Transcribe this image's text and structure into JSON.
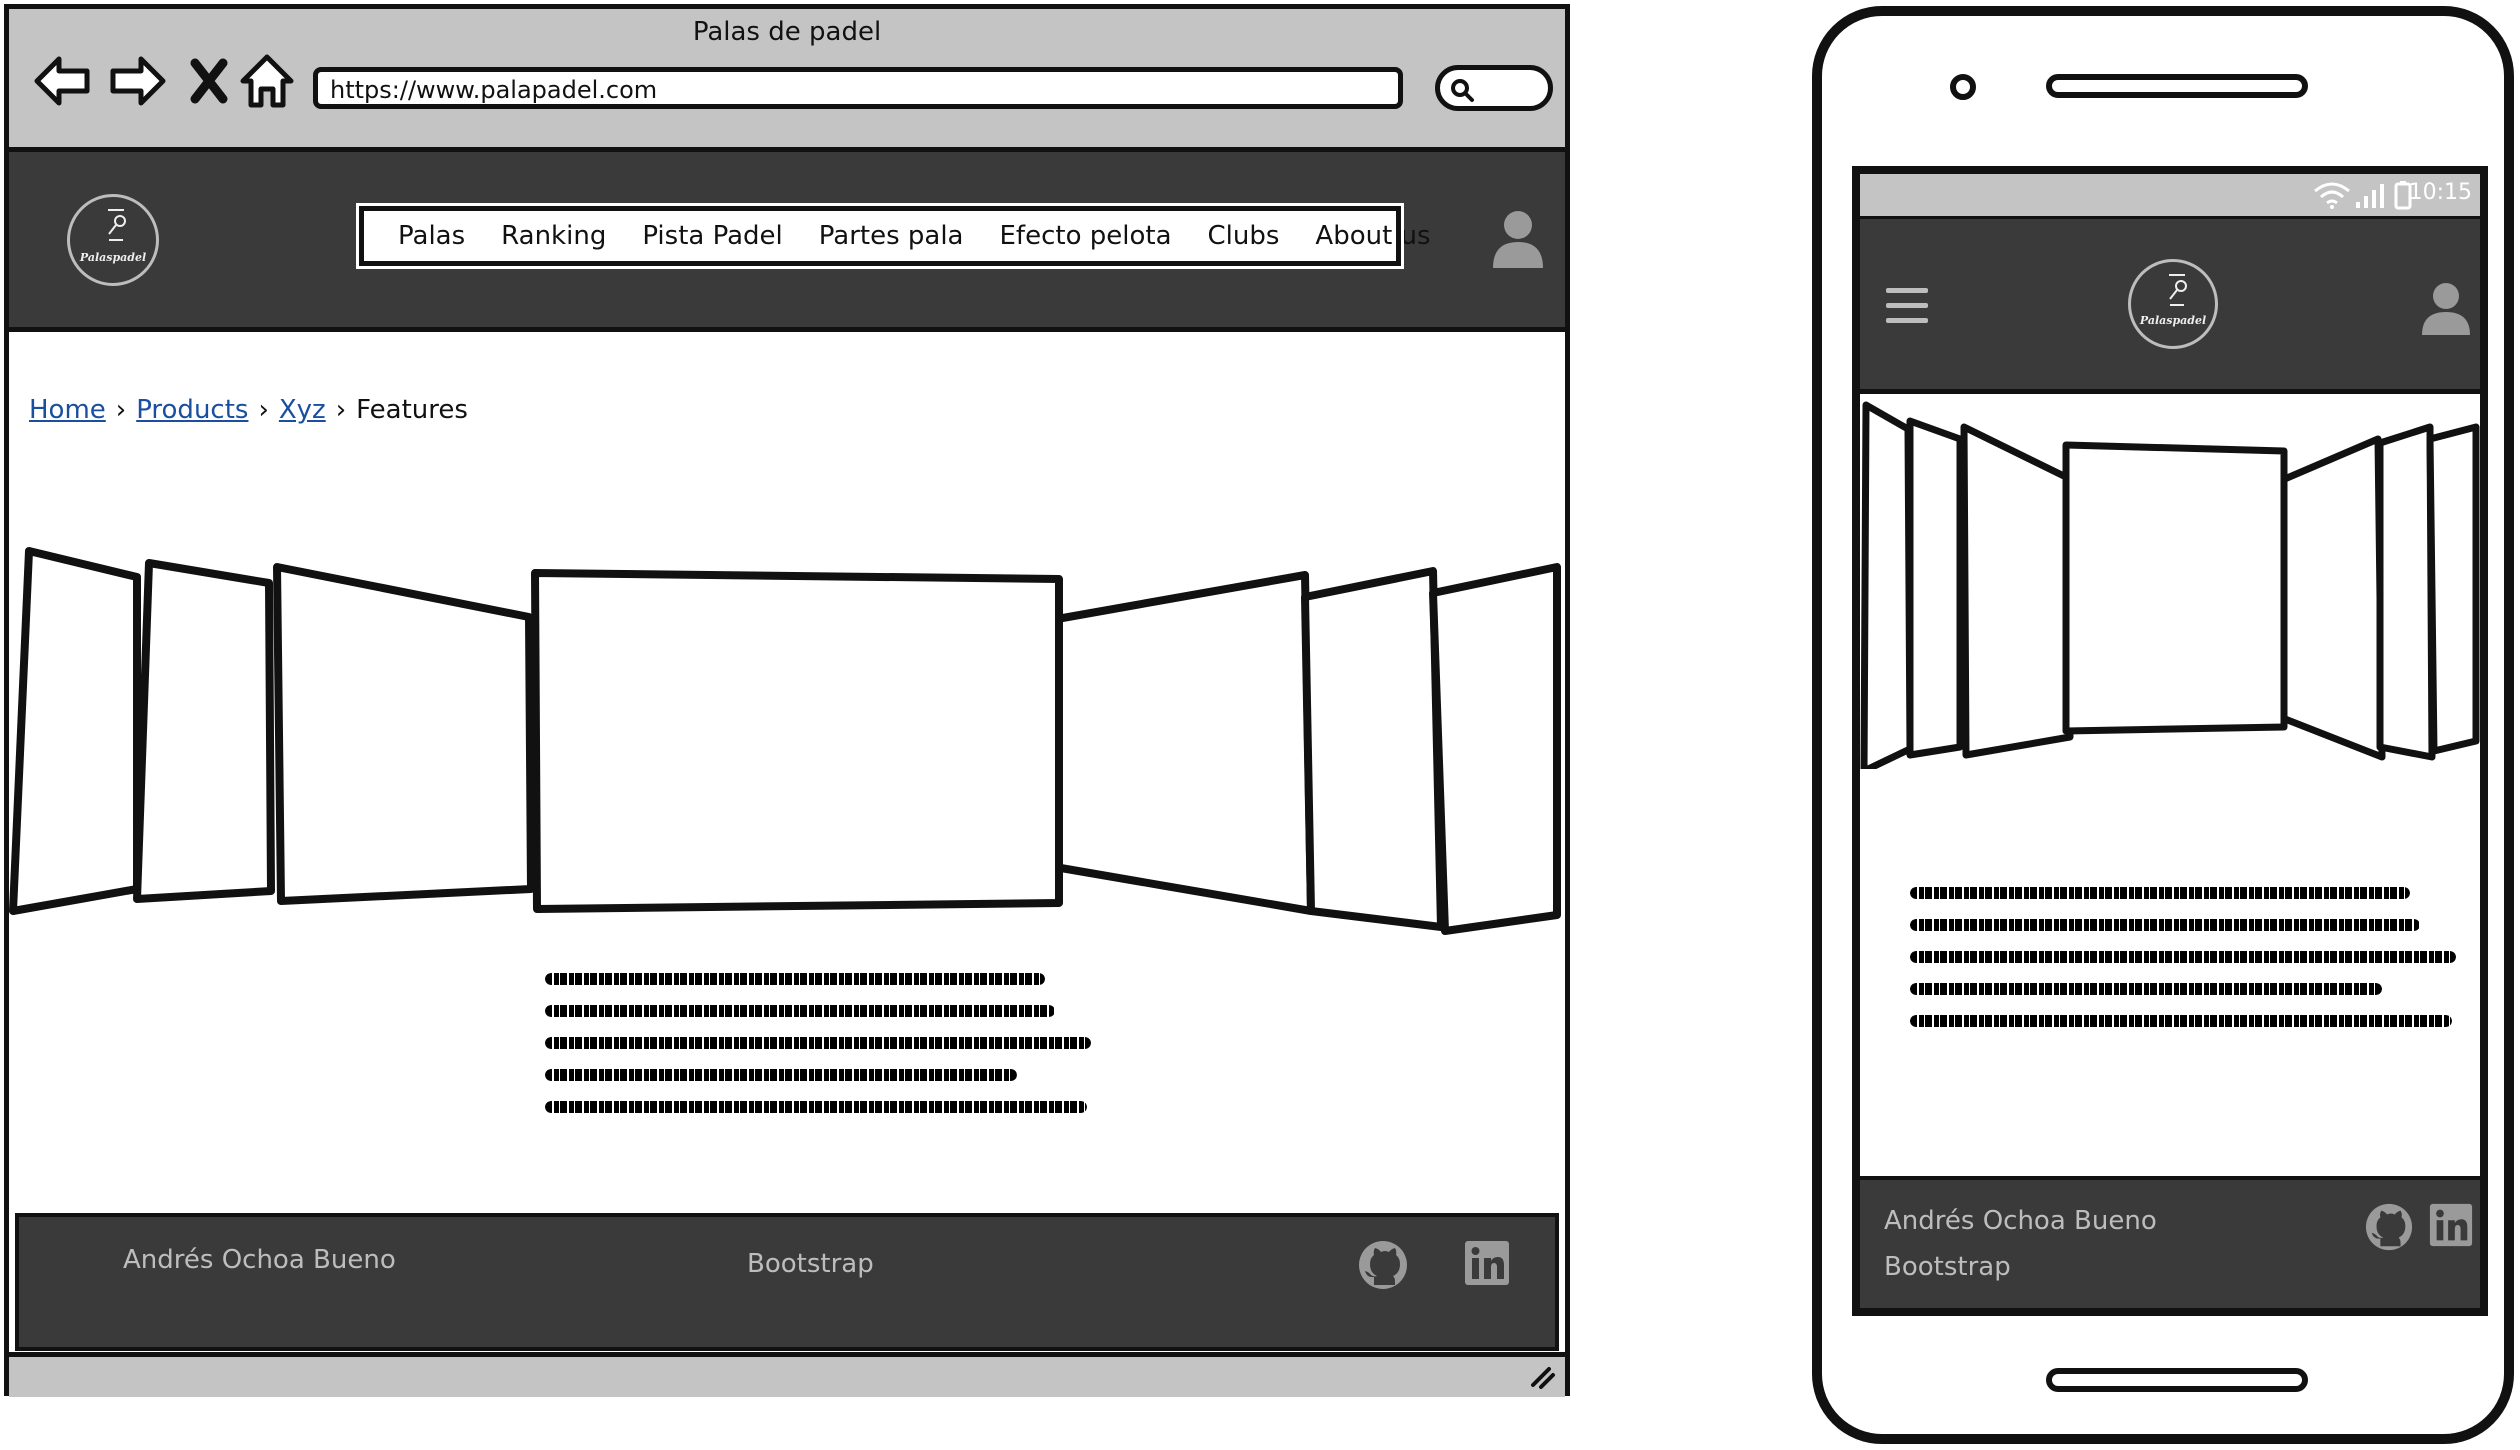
{
  "browser": {
    "window_title": "Palas de padel",
    "url": "https://www.palapadel.com",
    "nav_icons": [
      "back-arrow-icon",
      "forward-arrow-icon",
      "close-x-icon",
      "home-icon"
    ]
  },
  "site": {
    "logo_text": "Palaspadel",
    "menu": [
      "Palas",
      "Ranking",
      "Pista Padel",
      "Partes pala",
      "Efecto pelota",
      "Clubs",
      "About us"
    ],
    "user_icon": "user-icon"
  },
  "breadcrumb": {
    "links": [
      "Home",
      "Products",
      "Xyz"
    ],
    "current": "Features"
  },
  "footer": {
    "author": "Andrés Ochoa Bueno",
    "framework": "Bootstrap",
    "social_icons": [
      "github-icon",
      "linkedin-icon"
    ]
  },
  "mobile": {
    "time": "10:15",
    "logo_text": "Palaspadel",
    "footer_author": "Andrés Ochoa Bueno",
    "footer_framework": "Bootstrap"
  },
  "colors": {
    "chrome_gray": "#c4c4c4",
    "header_dark": "#3a3a3a",
    "link_blue": "#1a4fa0",
    "footer_text": "#bdbdbd"
  }
}
